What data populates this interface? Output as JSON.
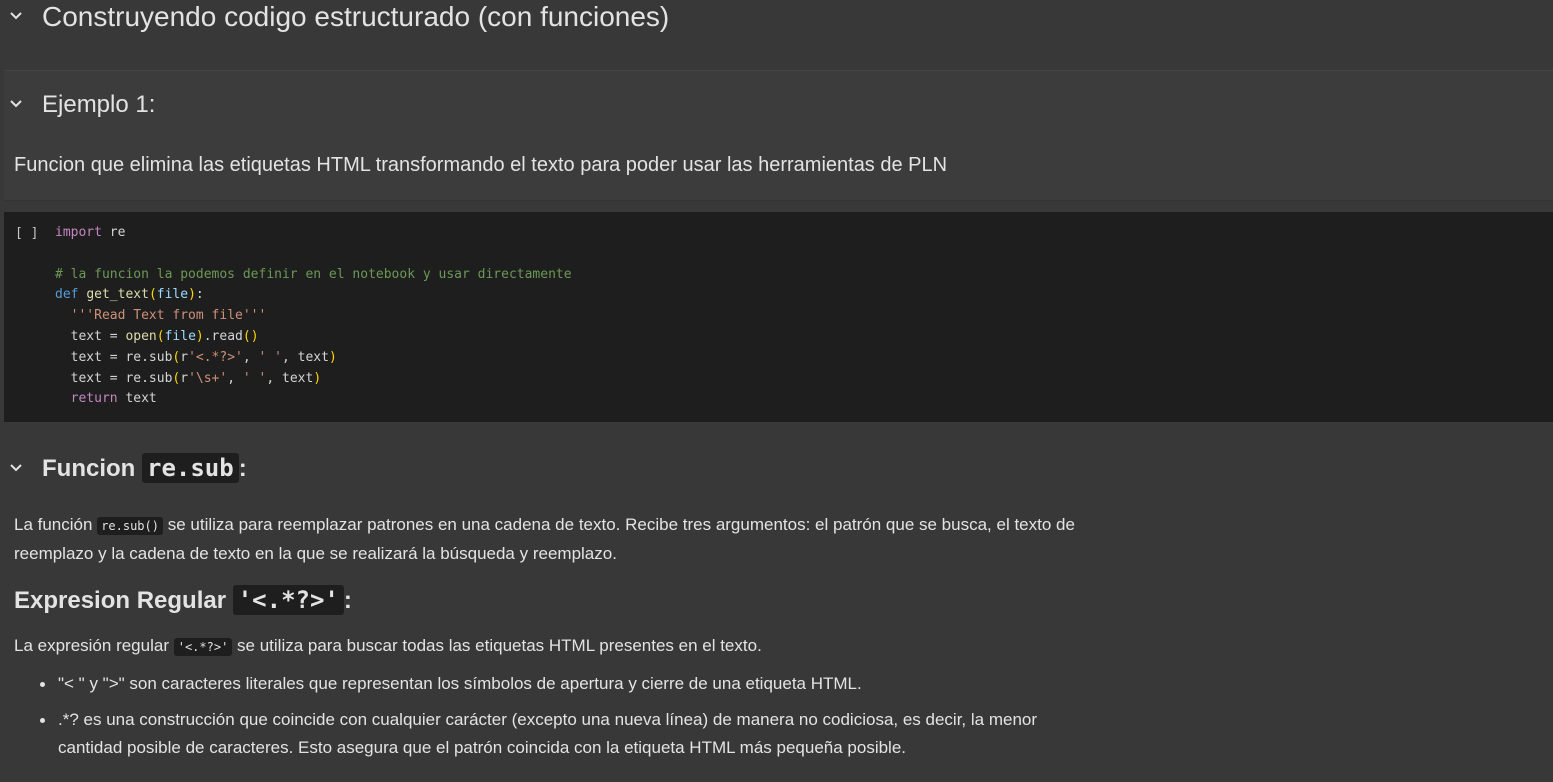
{
  "section_title": "Construyendo codigo estructurado (con funciones)",
  "example_title": "Ejemplo 1:",
  "example_desc": "Funcion que elimina las etiquetas HTML transformando el texto para poder usar las herramientas de PLN",
  "code_cell": {
    "run_indicator": "[ ]",
    "lines": [
      "import re",
      "",
      "# la funcion la podemos definir en el notebook y usar directamente",
      "def get_text(file):",
      "  '''Read Text from file'''",
      "  text = open(file).read()",
      "  text = re.sub(r'<.*?>', ' ', text)",
      "  text = re.sub(r'\\s+', ' ', text)",
      "  return text"
    ]
  },
  "resub_section": {
    "title_prefix": "Funcion",
    "title_code": "re.sub",
    "title_suffix": ":",
    "para_prefix": "La función",
    "para_code": "re.sub()",
    "para_suffix": "se utiliza para reemplazar patrones en una cadena de texto. Recibe tres argumentos: el patrón que se busca, el texto de reemplazo y la cadena de texto en la que se realizará la búsqueda y reemplazo."
  },
  "regex_section": {
    "title_prefix": "Expresion Regular",
    "title_code": "'<.*?>'",
    "title_suffix": ":",
    "para_prefix": "La expresión regular",
    "para_code": "'<.*?>'",
    "para_suffix": "se utiliza para buscar todas las etiquetas HTML presentes en el texto.",
    "bullets": [
      "\"< \" y \">\" son caracteres literales que representan los símbolos de apertura y cierre de una etiqueta HTML.",
      ".*? es una construcción que coincide con cualquier carácter (excepto una nueva línea) de manera no codiciosa, es decir, la menor cantidad posible de caracteres. Esto asegura que el patrón coincida con la etiqueta HTML más pequeña posible."
    ]
  }
}
